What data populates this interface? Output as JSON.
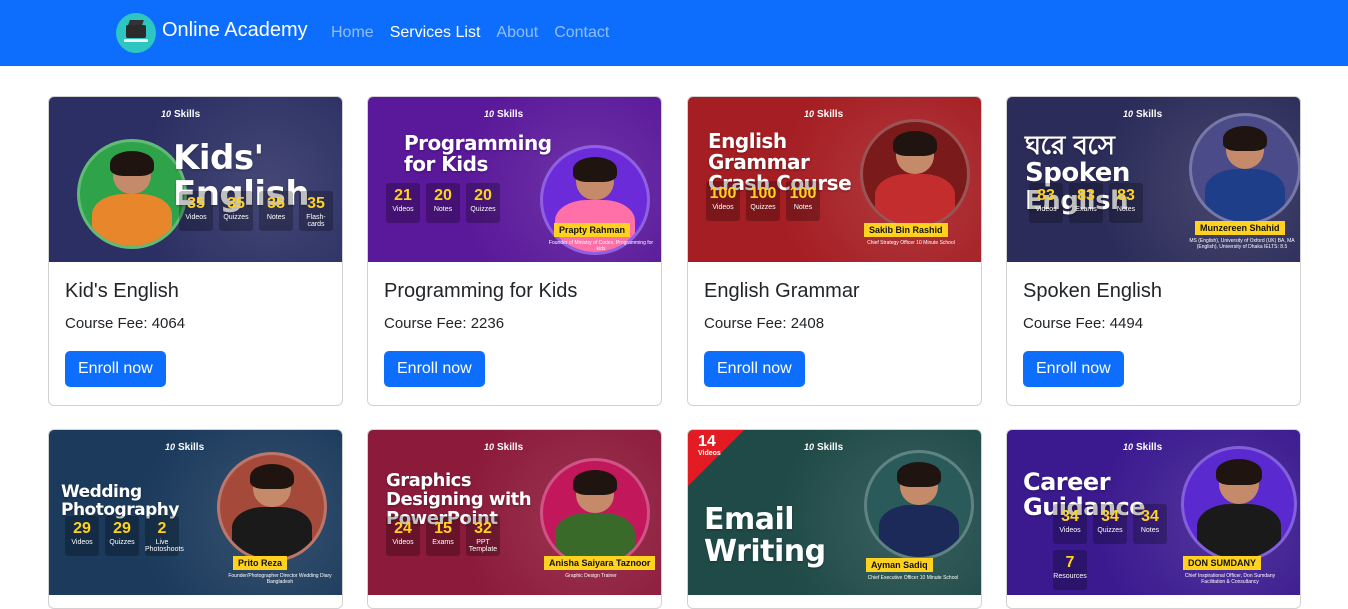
{
  "navbar": {
    "brand": "Online Academy",
    "links": [
      {
        "label": "Home",
        "active": false
      },
      {
        "label": "Services List",
        "active": true
      },
      {
        "label": "About",
        "active": false
      },
      {
        "label": "Contact",
        "active": false
      }
    ],
    "bg_color": "#0d6efd"
  },
  "thumb_brand": {
    "ten": "10 MINUTE SCHOOL",
    "skills": "Skills"
  },
  "courses": [
    {
      "title": "Kid's English",
      "fee_label": "Course Fee: 4064",
      "button": "Enroll now",
      "thumb": {
        "bg": "#2b2f63",
        "headline": "Kids' English",
        "stats": [
          {
            "n": "35",
            "l": "Videos"
          },
          {
            "n": "35",
            "l": "Quizzes"
          },
          {
            "n": "35",
            "l": "Notes"
          },
          {
            "n": "35",
            "l": "Flash-cards"
          }
        ],
        "name": "",
        "subtitle": ""
      }
    },
    {
      "title": "Programming for Kids",
      "fee_label": "Course Fee: 2236",
      "button": "Enroll now",
      "thumb": {
        "bg": "#5a189a",
        "headline": "Programming for Kids",
        "stats": [
          {
            "n": "21",
            "l": "Videos"
          },
          {
            "n": "20",
            "l": "Notes"
          },
          {
            "n": "20",
            "l": "Quizzes"
          }
        ],
        "name": "Prapty Rahman",
        "subtitle": "Founder of Ministry of Codes, Programming for kids"
      }
    },
    {
      "title": "English Grammar",
      "fee_label": "Course Fee: 2408",
      "button": "Enroll now",
      "thumb": {
        "bg": "#a51e23",
        "headline": "English Grammar Crash Course",
        "stats": [
          {
            "n": "100",
            "l": "Videos"
          },
          {
            "n": "100",
            "l": "Quizzes"
          },
          {
            "n": "100",
            "l": "Notes"
          }
        ],
        "name": "Sakib Bin Rashid",
        "subtitle": "Chief Strategy Officer 10 Minute School"
      }
    },
    {
      "title": "Spoken English",
      "fee_label": "Course Fee: 4494",
      "button": "Enroll now",
      "thumb": {
        "bg": "#2c2c5a",
        "headline": "ঘরে বসে Spoken English",
        "stats": [
          {
            "n": "83",
            "l": "Videos"
          },
          {
            "n": "83",
            "l": "Exams"
          },
          {
            "n": "83",
            "l": "Notes"
          }
        ],
        "name": "Munzereen Shahid",
        "subtitle": "MS (English), University of Oxford (UK) BA, MA (English), University of Dhaka IELTS: 8.5"
      }
    },
    {
      "title": "",
      "fee_label": "",
      "button": "",
      "thumb": {
        "bg": "#1b3a5c",
        "headline": "Wedding Photography",
        "stats": [
          {
            "n": "29",
            "l": "Videos"
          },
          {
            "n": "29",
            "l": "Quizzes"
          },
          {
            "n": "2",
            "l": "Live Photoshoots"
          }
        ],
        "name": "Prito Reza",
        "subtitle": "Founder/Photographer Director Wedding Diary Bangladesh"
      }
    },
    {
      "title": "",
      "fee_label": "",
      "button": "",
      "thumb": {
        "bg": "#8c1a3a",
        "headline": "Graphics Designing with PowerPoint",
        "stats": [
          {
            "n": "24",
            "l": "Videos"
          },
          {
            "n": "15",
            "l": "Exams"
          },
          {
            "n": "32",
            "l": "PPT Template"
          }
        ],
        "name": "Anisha Saiyara Taznoor",
        "subtitle": "Graphic Design Trainer"
      }
    },
    {
      "title": "",
      "fee_label": "",
      "button": "",
      "thumb": {
        "bg": "#1f4a48",
        "headline": "Email Writing",
        "stats": [],
        "corner_num": "14",
        "corner_label": "Videos",
        "name": "Ayman Sadiq",
        "subtitle": "Chief Executive Officer 10 Minute School"
      }
    },
    {
      "title": "",
      "fee_label": "",
      "button": "",
      "thumb": {
        "bg": "#3b1a8f",
        "headline": "Career Guidance",
        "stats": [
          {
            "n": "34",
            "l": "Videos"
          },
          {
            "n": "34",
            "l": "Quizzes"
          },
          {
            "n": "34",
            "l": "Notes"
          },
          {
            "n": "7",
            "l": "Resources"
          }
        ],
        "name": "DON SUMDANY",
        "subtitle": "Chief Inspirational Officer, Don Sumdany Facilitation & Consultancy"
      }
    }
  ]
}
